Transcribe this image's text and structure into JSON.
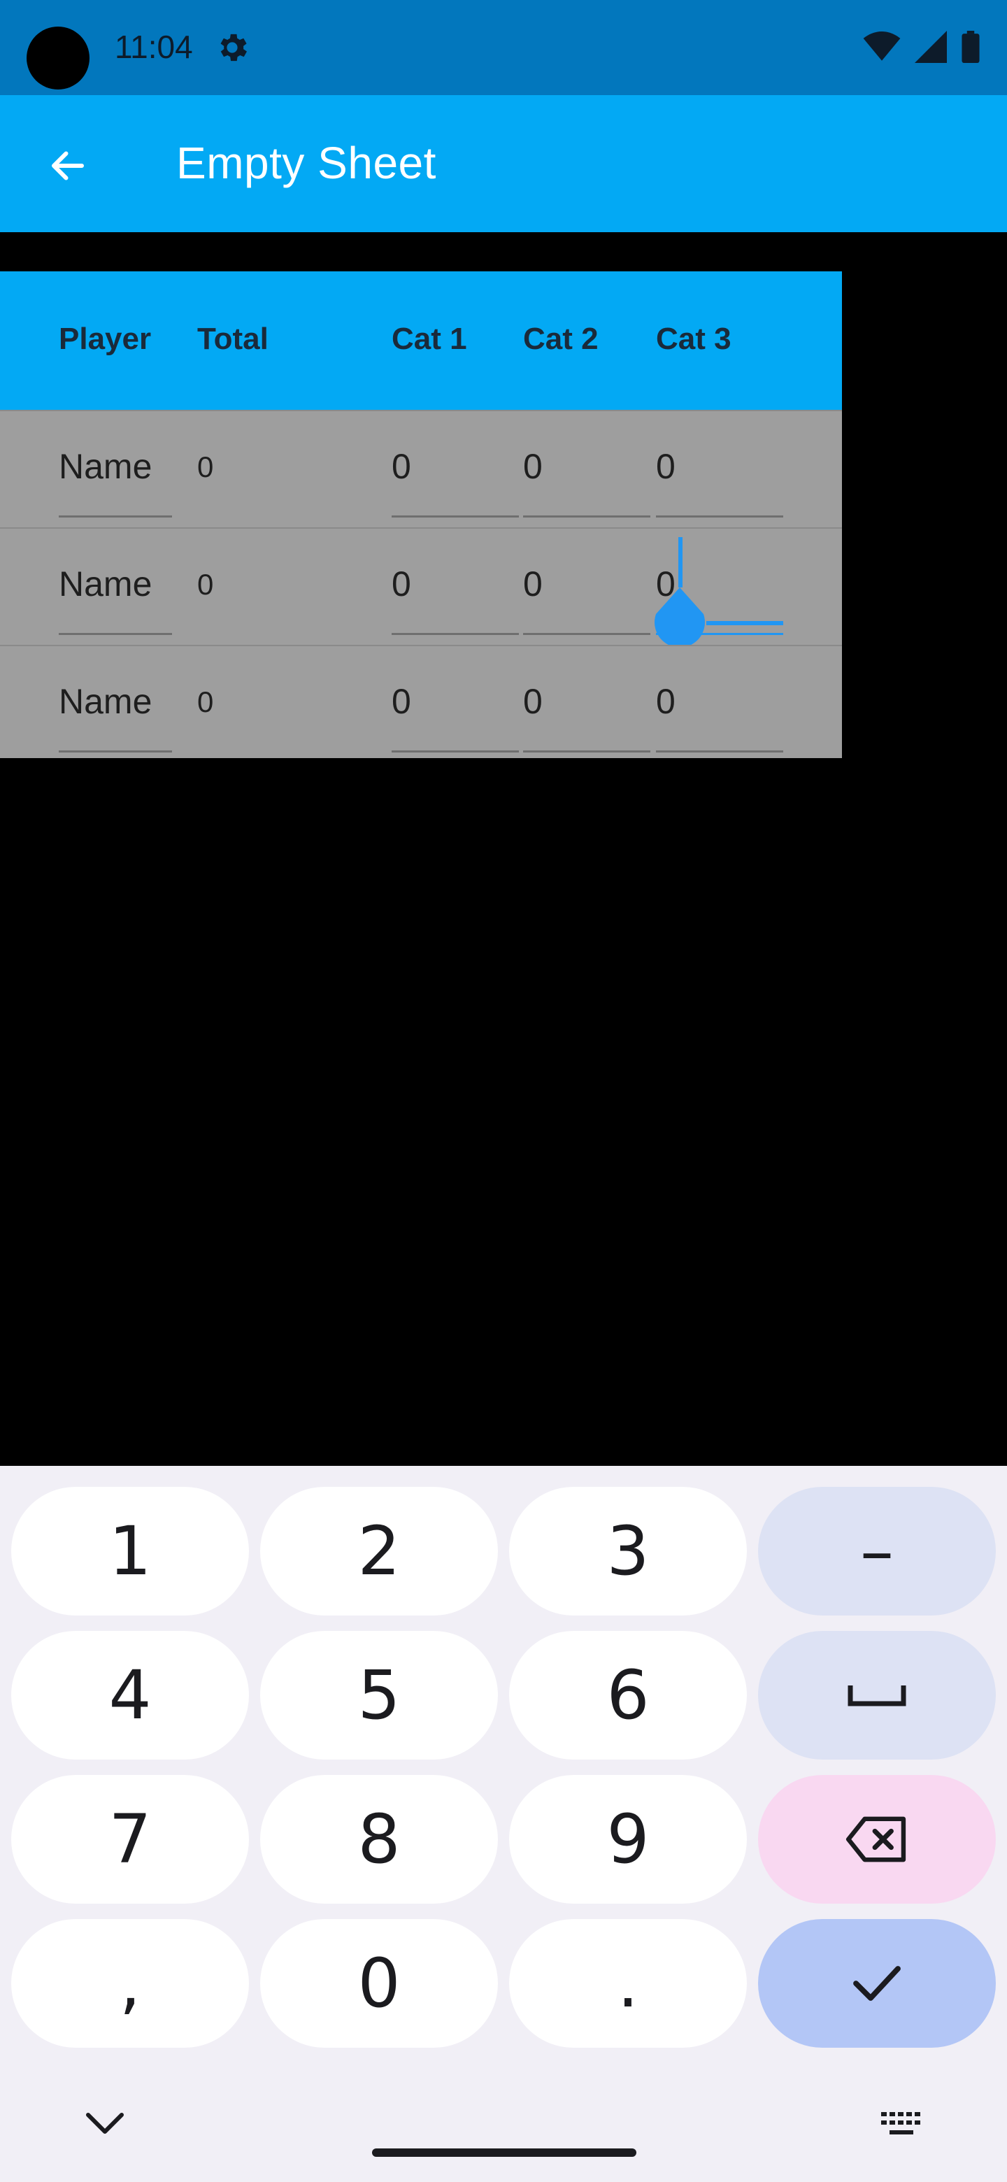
{
  "status_bar": {
    "time": "11:04"
  },
  "app_bar": {
    "title": "Empty Sheet"
  },
  "table": {
    "headers": [
      "Player",
      "Total",
      "Cat 1",
      "Cat 2",
      "Cat 3"
    ],
    "rows": [
      {
        "player": "Name",
        "total": "0",
        "cat1": "0",
        "cat2": "0",
        "cat3": "0"
      },
      {
        "player": "Name",
        "total": "0",
        "cat1": "0",
        "cat2": "0",
        "cat3": "0"
      },
      {
        "player": "Name",
        "total": "0",
        "cat1": "0",
        "cat2": "0",
        "cat3": "0"
      }
    ]
  },
  "keyboard": {
    "keys": [
      "1",
      "2",
      "3",
      "–",
      "4",
      "5",
      "6",
      "␣",
      "7",
      "8",
      "9",
      "⌫",
      ",",
      "0",
      ".",
      "✓"
    ]
  },
  "colors": {
    "status_bar": "#0277bd",
    "app_bar": "#03a9f4",
    "table_header": "#03a9f4",
    "table_row": "#9e9e9e",
    "accent": "#2196f3",
    "keyboard_bg": "#f1eff6"
  }
}
